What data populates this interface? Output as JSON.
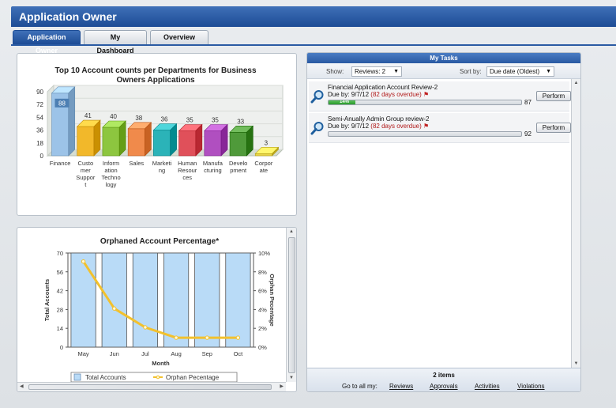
{
  "app": {
    "title": "Application Owner"
  },
  "tabs": [
    {
      "label": "Application Owner",
      "active": true
    },
    {
      "label": "My Dashboard",
      "active": false
    },
    {
      "label": "Overview",
      "active": false
    }
  ],
  "chart_data": [
    {
      "type": "bar",
      "title": "Top 10 Account counts per Departments for Business Owners Applications",
      "categories": [
        "Finance",
        "Customer Support",
        "Information Technology",
        "Sales",
        "Marketing",
        "Human Resources",
        "Manufacturing",
        "Development",
        "Corporate"
      ],
      "category_labels": [
        [
          "Finance"
        ],
        [
          "Custo",
          "mer",
          "Suppor",
          "t"
        ],
        [
          "Inform",
          "ation",
          "Techno",
          "logy"
        ],
        [
          "Sales"
        ],
        [
          "Marketi",
          "ng"
        ],
        [
          "Human",
          "Resour",
          "ces"
        ],
        [
          "Manufa",
          "cturing"
        ],
        [
          "Develo",
          "pment"
        ],
        [
          "Corpor",
          "ate"
        ]
      ],
      "values": [
        88,
        41,
        40,
        38,
        36,
        35,
        35,
        33,
        3
      ],
      "colors": [
        "#9cc3e8",
        "#f2b82a",
        "#8dc63f",
        "#f08a4b",
        "#2bb3b8",
        "#e0505a",
        "#b04fc0",
        "#4f9a3a",
        "#e8d44a"
      ],
      "yticks": [
        0,
        18,
        36,
        54,
        72,
        90
      ],
      "ylim": [
        0,
        90
      ]
    },
    {
      "type": "bar+line",
      "title": "Orphaned Account Percentage*",
      "categories": [
        "May",
        "Jun",
        "Jul",
        "Aug",
        "Sep",
        "Oct"
      ],
      "xlabel": "Month",
      "ylabel": "Total Accounts",
      "y2label": "Orphan Pecentage",
      "yticks": [
        0,
        14,
        28,
        42,
        56,
        70
      ],
      "y2ticks": [
        "0%",
        "2%",
        "4%",
        "6%",
        "8%",
        "10%"
      ],
      "ylim": [
        0,
        70
      ],
      "y2lim": [
        0,
        10
      ],
      "series": [
        {
          "name": "Total Accounts",
          "values": [
            70,
            70,
            70,
            70,
            70,
            70
          ],
          "color": "#b9dbf7"
        },
        {
          "name": "Orphan Pecentage",
          "values": [
            9.1,
            4.1,
            2.1,
            1.0,
            1.0,
            1.0
          ],
          "color": "#f2c12e"
        }
      ],
      "legend": "bottom"
    }
  ],
  "tasks": {
    "header": "My Tasks",
    "show_label": "Show:",
    "show_value": "Reviews: 2",
    "sort_label": "Sort by:",
    "sort_value": "Due date (Oldest)",
    "items": [
      {
        "name": "Financial Application Account Review-2",
        "due_prefix": "Due by: 9/7/12",
        "overdue": "(82 days overdue)",
        "progress": 14,
        "progress_label": "14%",
        "count": "87",
        "button": "Perform"
      },
      {
        "name": "Semi-Anually Admin Group review-2",
        "due_prefix": "Due by: 9/7/12",
        "overdue": "(82 days overdue)",
        "progress": 0,
        "progress_label": "",
        "count": "92",
        "button": "Perform"
      }
    ],
    "footer_count": "2 items",
    "goto_label": "Go to all my:",
    "links": [
      "Reviews",
      "Approvals",
      "Activities",
      "Violations"
    ]
  },
  "icons": {
    "task": "magnifier-icon",
    "flag": "flag-icon"
  }
}
